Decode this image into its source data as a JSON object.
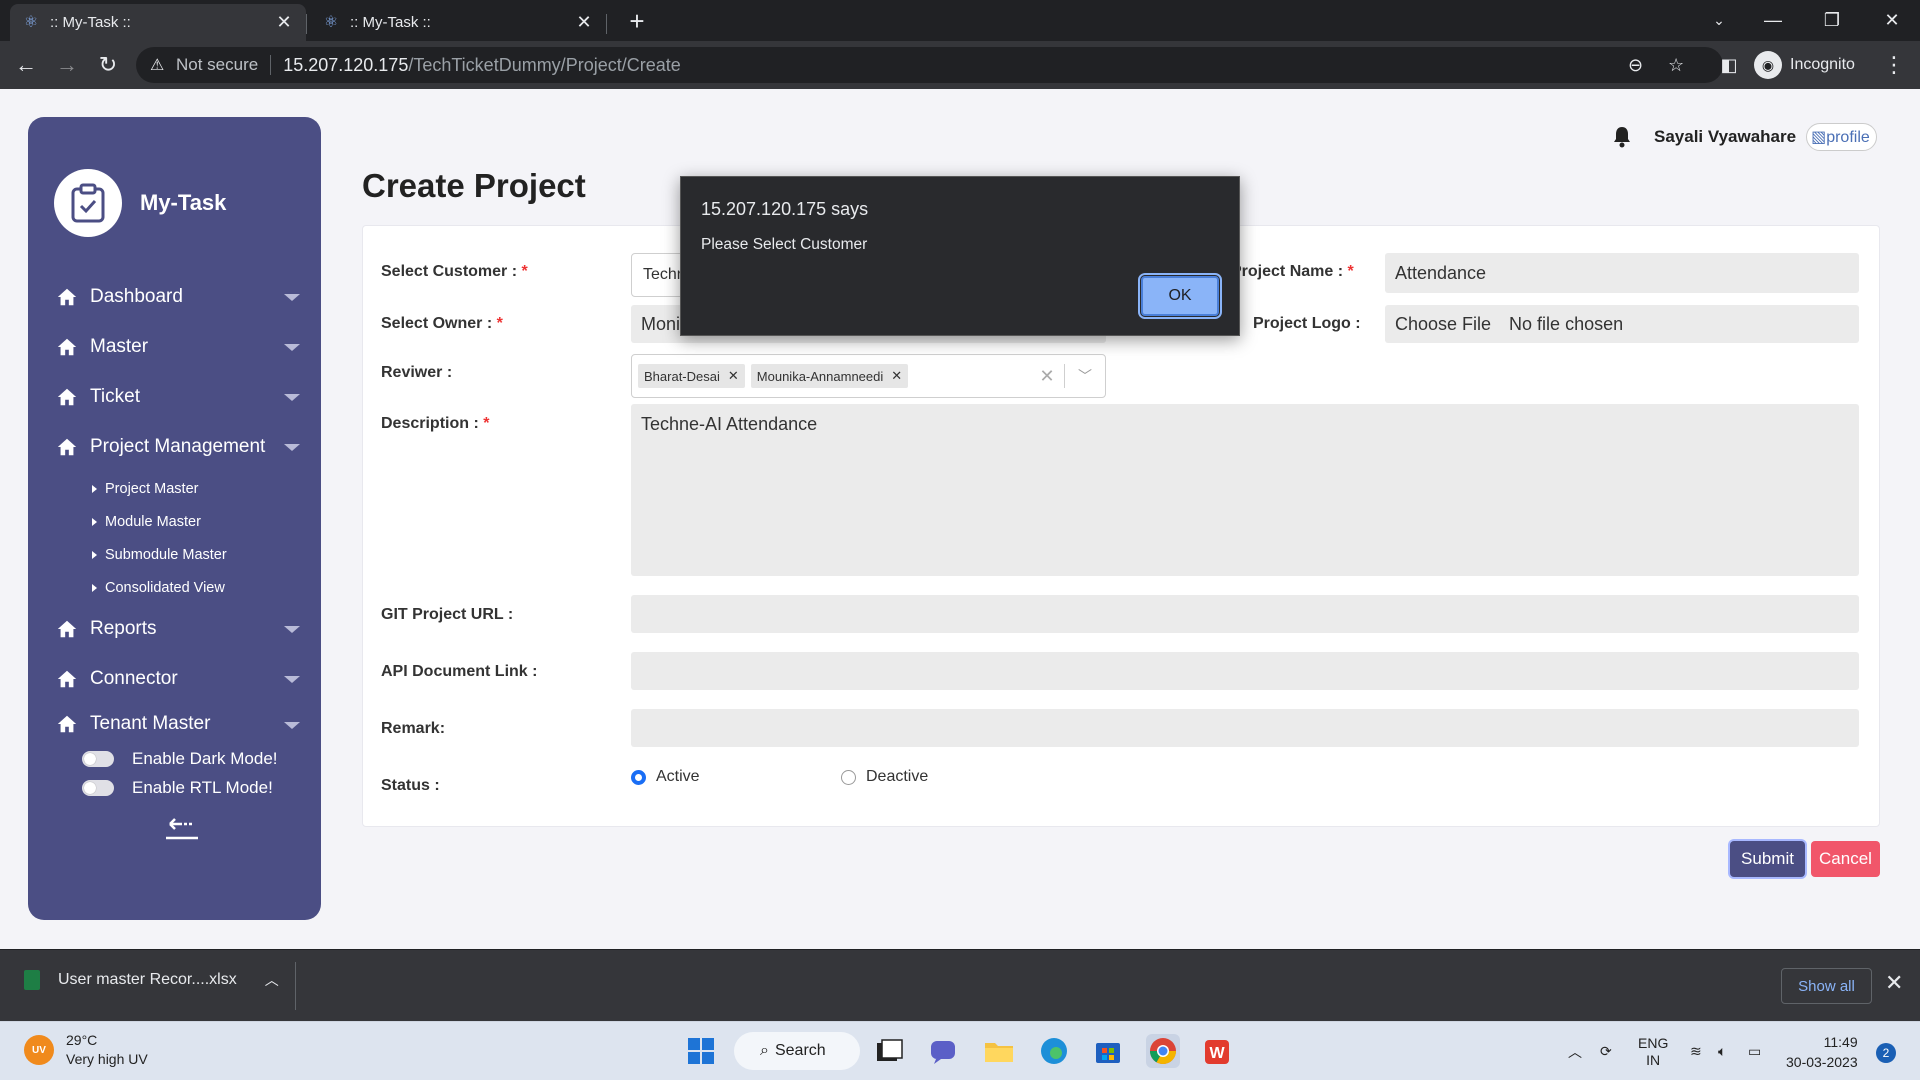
{
  "browser": {
    "tabs": [
      {
        "title": ":: My-Task ::",
        "active": true
      },
      {
        "title": ":: My-Task ::",
        "active": false
      }
    ],
    "security_label": "Not secure",
    "url_host": "15.207.120.175",
    "url_path": "/TechTicketDummy/Project/Create",
    "profile_label": "Incognito"
  },
  "sidebar": {
    "brand": "My-Task",
    "nav": [
      {
        "label": "Dashboard"
      },
      {
        "label": "Master"
      },
      {
        "label": "Ticket"
      },
      {
        "label": "Project Management"
      }
    ],
    "sub_items": [
      {
        "label": "Project Master"
      },
      {
        "label": "Module Master"
      },
      {
        "label": "Submodule Master"
      },
      {
        "label": "Consolidated View"
      }
    ],
    "nav_after": [
      {
        "label": "Reports"
      },
      {
        "label": "Connector"
      },
      {
        "label": "Tenant Master"
      }
    ],
    "toggles": [
      {
        "label": "Enable Dark Mode!"
      },
      {
        "label": "Enable RTL Mode!"
      }
    ]
  },
  "header": {
    "username": "Sayali Vyawahare",
    "profile_alt": "profile"
  },
  "form": {
    "title": "Create Project",
    "customer_label": "Select Customer :",
    "customer_value": "Techneai",
    "owner_label": "Select Owner :",
    "owner_value": "Monika Dilip Kolpe",
    "reviewer_label": "Reviwer :",
    "reviewers": [
      "Bharat-Desai",
      "Mounika-Annamneedi"
    ],
    "description_label": "Description :",
    "description_value": "Techne-AI Attendance",
    "project_name_label": "Project Name :",
    "project_name_value": "Attendance",
    "project_logo_label": "Project Logo :",
    "choose_file": "Choose File",
    "no_file": "No file chosen",
    "git_label": "GIT Project URL :",
    "git_value": "",
    "api_label": "API Document Link :",
    "api_value": "",
    "remark_label": "Remark:",
    "remark_value": "",
    "status_label": "Status :",
    "status_options": [
      {
        "label": "Active",
        "selected": true
      },
      {
        "label": "Deactive",
        "selected": false
      }
    ],
    "submit": "Submit",
    "cancel": "Cancel"
  },
  "dialog": {
    "title": "15.207.120.175 says",
    "message": "Please Select Customer",
    "ok": "OK"
  },
  "downloads": {
    "file": "User master Recor....xlsx",
    "show_all": "Show all"
  },
  "taskbar": {
    "uv_badge": "UV",
    "temperature": "29°C",
    "weather": "Very high UV",
    "search": "Search",
    "lang_line1": "ENG",
    "lang_line2": "IN",
    "time": "11:49",
    "date": "30-03-2023",
    "notifications": "2"
  },
  "colors": {
    "sidebar": "#4b4e84",
    "submit": "#4b4e84",
    "cancel": "#f1566a",
    "required": "#e33333",
    "radio_active": "#1a6ef5"
  }
}
